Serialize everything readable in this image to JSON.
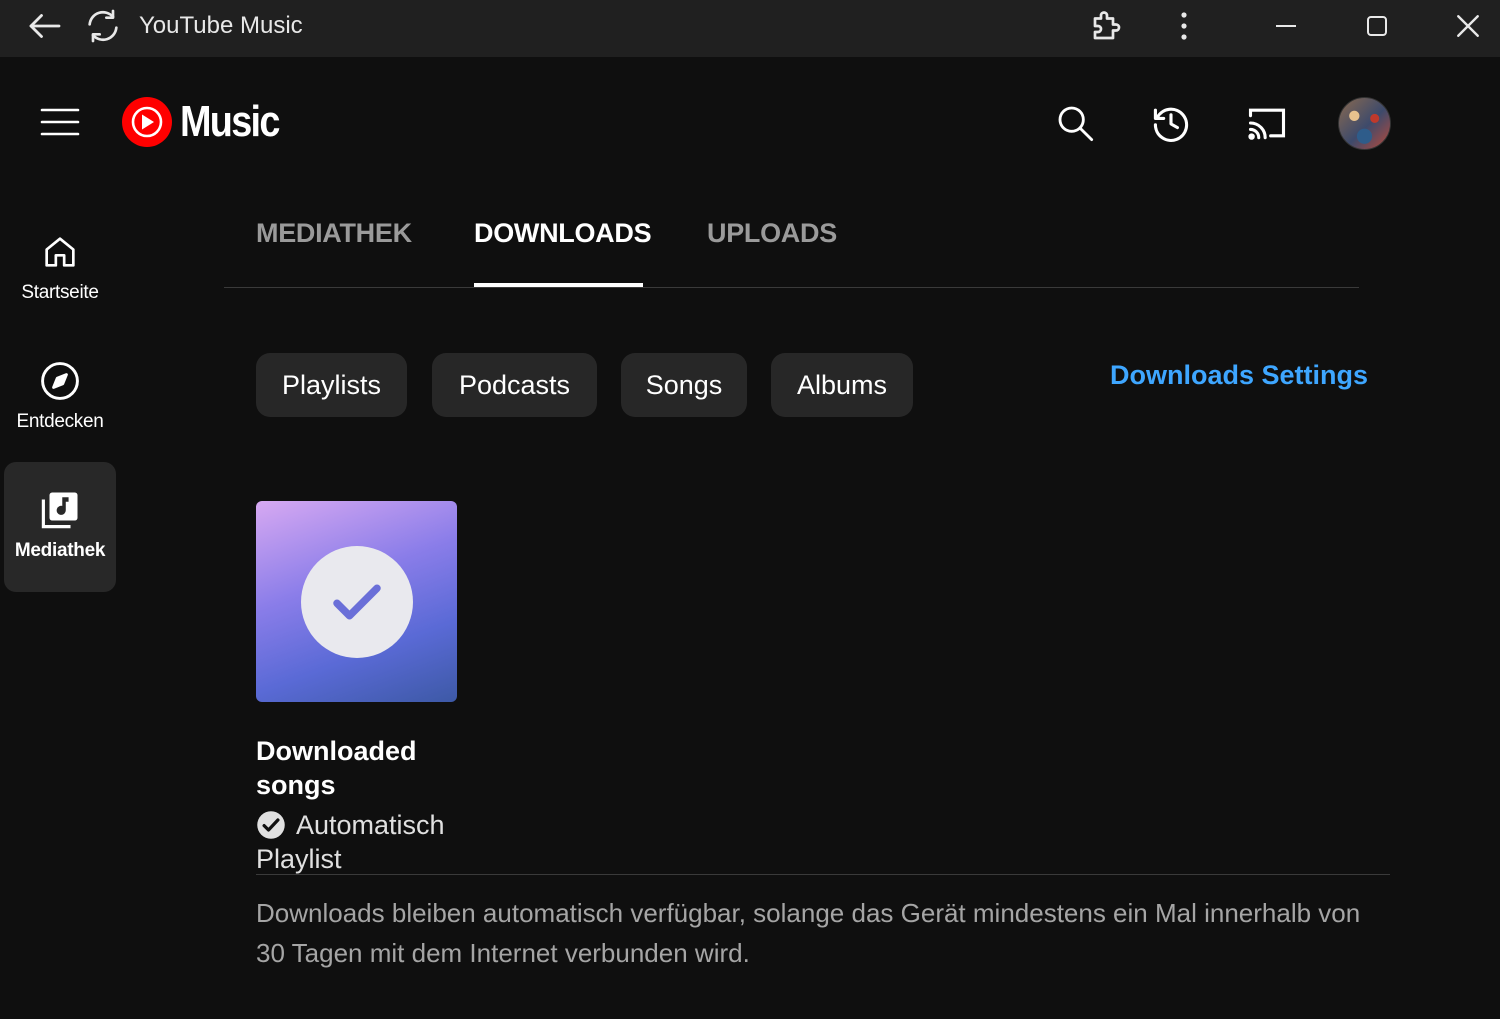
{
  "window": {
    "title": "YouTube Music",
    "icons": [
      "back-arrow-icon",
      "reload-icon",
      "extensions-icon",
      "more-vert-icon",
      "minimize-icon",
      "maximize-icon",
      "close-icon"
    ]
  },
  "header": {
    "logo_text": "Music",
    "brand_color": "#ff0000",
    "icons": [
      "menu-icon",
      "search-icon",
      "history-icon",
      "cast-icon",
      "avatar"
    ]
  },
  "sidebar": {
    "items": [
      {
        "label": "Startseite",
        "icon": "home-icon",
        "active": false
      },
      {
        "label": "Entdecken",
        "icon": "compass-icon",
        "active": false
      },
      {
        "label": "Mediathek",
        "icon": "library-icon",
        "active": true
      }
    ]
  },
  "tabs": [
    {
      "label": "MEDIATHEK",
      "active": false
    },
    {
      "label": "DOWNLOADS",
      "active": true
    },
    {
      "label": "UPLOADS",
      "active": false
    }
  ],
  "chips": [
    {
      "label": "Playlists"
    },
    {
      "label": "Podcasts"
    },
    {
      "label": "Songs"
    },
    {
      "label": "Albums"
    }
  ],
  "settings_link": {
    "label": "Downloads Settings",
    "color": "#3ea6ff"
  },
  "card": {
    "title": "Downloaded songs",
    "subtitle": "Automatisch Playlist",
    "thumb_icon": "check-circle-icon",
    "badge_icon": "verified-check-icon"
  },
  "footer_note": "Downloads bleiben automatisch verfügbar, solange das Gerät mindestens ein Mal innerhalb von 30 Tagen mit dem Internet verbunden wird."
}
